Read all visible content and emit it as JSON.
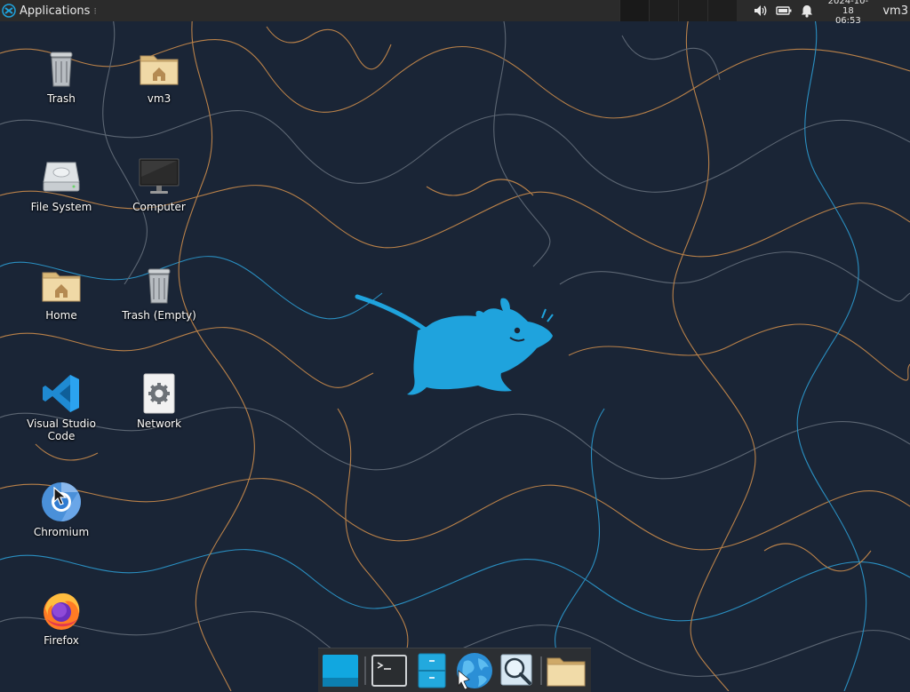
{
  "top_panel": {
    "applications_label": "Applications",
    "applications_separator": "⁝",
    "clock_date": "2024-10-18",
    "clock_time": "06:53",
    "user_name": "vm3",
    "workspaces_count": 4
  },
  "desktop_icons": [
    {
      "label": "Trash",
      "icon": "trash-icon"
    },
    {
      "label": "vm3",
      "icon": "home-folder-icon"
    },
    {
      "label": "File System",
      "icon": "drive-icon"
    },
    {
      "label": "Computer",
      "icon": "monitor-icon"
    },
    {
      "label": "Home",
      "icon": "home-folder-icon"
    },
    {
      "label": "Trash (Empty)",
      "icon": "trash-icon"
    },
    {
      "label": "Visual Studio Code",
      "icon": "vscode-icon"
    },
    {
      "label": "Network",
      "icon": "gear-icon"
    },
    {
      "label": "Chromium",
      "icon": "chromium-icon"
    },
    {
      "label": "Firefox",
      "icon": "firefox-icon"
    }
  ],
  "dock_items": [
    {
      "name": "show-desktop",
      "icon": "desktop-icon"
    },
    {
      "name": "terminal",
      "icon": "terminal-icon"
    },
    {
      "name": "file-manager",
      "icon": "file-cabinet-icon"
    },
    {
      "name": "web-browser",
      "icon": "globe-icon"
    },
    {
      "name": "app-finder",
      "icon": "magnifier-icon"
    },
    {
      "name": "home-folder",
      "icon": "folder-icon"
    }
  ],
  "colors": {
    "panel_bg": "#2b2b2b",
    "wallpaper_bg": "#1a2536",
    "wallpaper_line_orange": "#c98a4a",
    "wallpaper_line_blue": "#2a8fc1",
    "wallpaper_line_gray": "#5c6673",
    "xfce_blue": "#1fa3dd",
    "dock_bg": "#2c2f33"
  }
}
